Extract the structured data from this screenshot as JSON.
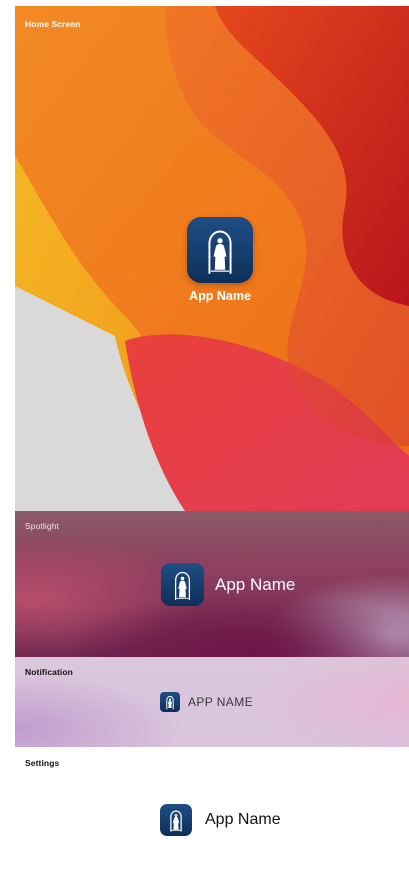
{
  "app": {
    "name": "App Name",
    "name_caps": "APP NAME",
    "icon": "statue-arch-icon",
    "icon_colors": {
      "background_top": "#1e4f85",
      "background_bottom": "#0f2f5a",
      "figure": "#ffffff"
    }
  },
  "sections": {
    "home_screen": {
      "label": "Home Screen"
    },
    "spotlight": {
      "label": "Spotlight"
    },
    "notification": {
      "label": "Notification"
    },
    "settings": {
      "label": "Settings"
    }
  },
  "colors": {
    "wallpaper_orange": "#f07a1c",
    "wallpaper_red": "#d8281e",
    "wallpaper_yellow": "#f2b01e",
    "wallpaper_gray": "#d9d9d9"
  }
}
